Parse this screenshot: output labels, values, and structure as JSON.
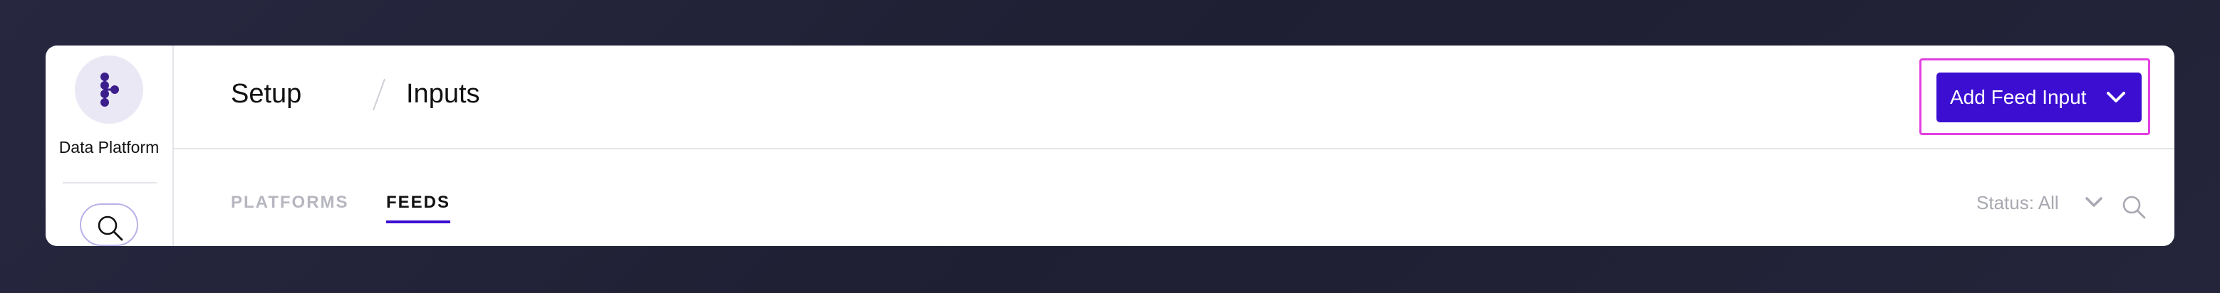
{
  "app": {
    "name": "Data Platform",
    "logo_icon": "data-platform-logo-icon"
  },
  "sidebar": {
    "search_icon": "search-icon"
  },
  "breadcrumb": {
    "items": [
      "Setup",
      "Inputs"
    ],
    "separator": "/"
  },
  "header": {
    "primary_action": {
      "label": "Add Feed Input",
      "icon": "chevron-down-icon"
    }
  },
  "tabs": {
    "items": [
      {
        "label": "PLATFORMS",
        "active": false
      },
      {
        "label": "FEEDS",
        "active": true
      }
    ]
  },
  "filters": {
    "status_label": "Status: All",
    "status_icon": "chevron-down-icon",
    "search_icon": "search-icon"
  },
  "colors": {
    "accent": "#3c0ed2",
    "highlight": "#e23fe0",
    "logo_bg": "#ebe8f6",
    "logo_fg": "#3b1d8c"
  }
}
